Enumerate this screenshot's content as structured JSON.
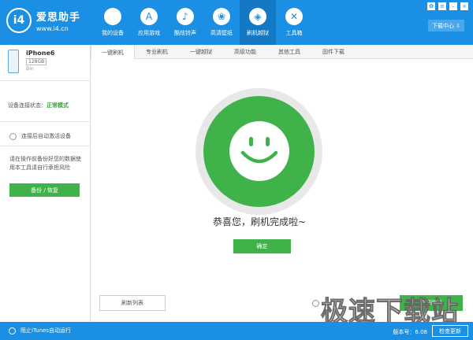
{
  "app": {
    "logo_badge": "i4",
    "name": "爱思助手",
    "url": "www.i4.cn"
  },
  "nav": [
    {
      "label": "我的设备",
      "icon": "apple-icon",
      "glyph": ""
    },
    {
      "label": "应用游戏",
      "icon": "app-store-icon",
      "glyph": "A"
    },
    {
      "label": "酷炫铃声",
      "icon": "bell-icon",
      "glyph": "♪"
    },
    {
      "label": "高清壁纸",
      "icon": "wallpaper-icon",
      "glyph": "❀"
    },
    {
      "label": "刷机越狱",
      "icon": "dropbox-icon",
      "glyph": "◈"
    },
    {
      "label": "工具箱",
      "icon": "tools-icon",
      "glyph": "✕"
    }
  ],
  "header": {
    "download_center": "下载中心"
  },
  "device": {
    "name": "iPhone6",
    "capacity": "128GB",
    "color": "Bin"
  },
  "sidebar": {
    "connection_label": "设备连接状态：",
    "connection_value": "正常模式",
    "auto_activate": "连接后自动激活设备",
    "warning": "请在操作前备份好您的数据使用本工具请自行承担风险",
    "backup_button": "备份 / 恢复"
  },
  "tabs": [
    "一键刷机",
    "专业刷机",
    "一键越狱",
    "高级功能",
    "其他工具",
    "固件下载"
  ],
  "main": {
    "done_message": "恭喜您，刷机完成啦~",
    "ok_button": "确定",
    "refresh_button": "刷新列表",
    "flash_button": "立即刷机"
  },
  "statusbar": {
    "itunes": "阻止iTunes自动运行",
    "version": "版本号：6.08",
    "check_update": "检查更新"
  },
  "watermark": "极速下载站",
  "colors": {
    "brand_blue": "#1a8fe3",
    "green": "#3fb24a"
  }
}
